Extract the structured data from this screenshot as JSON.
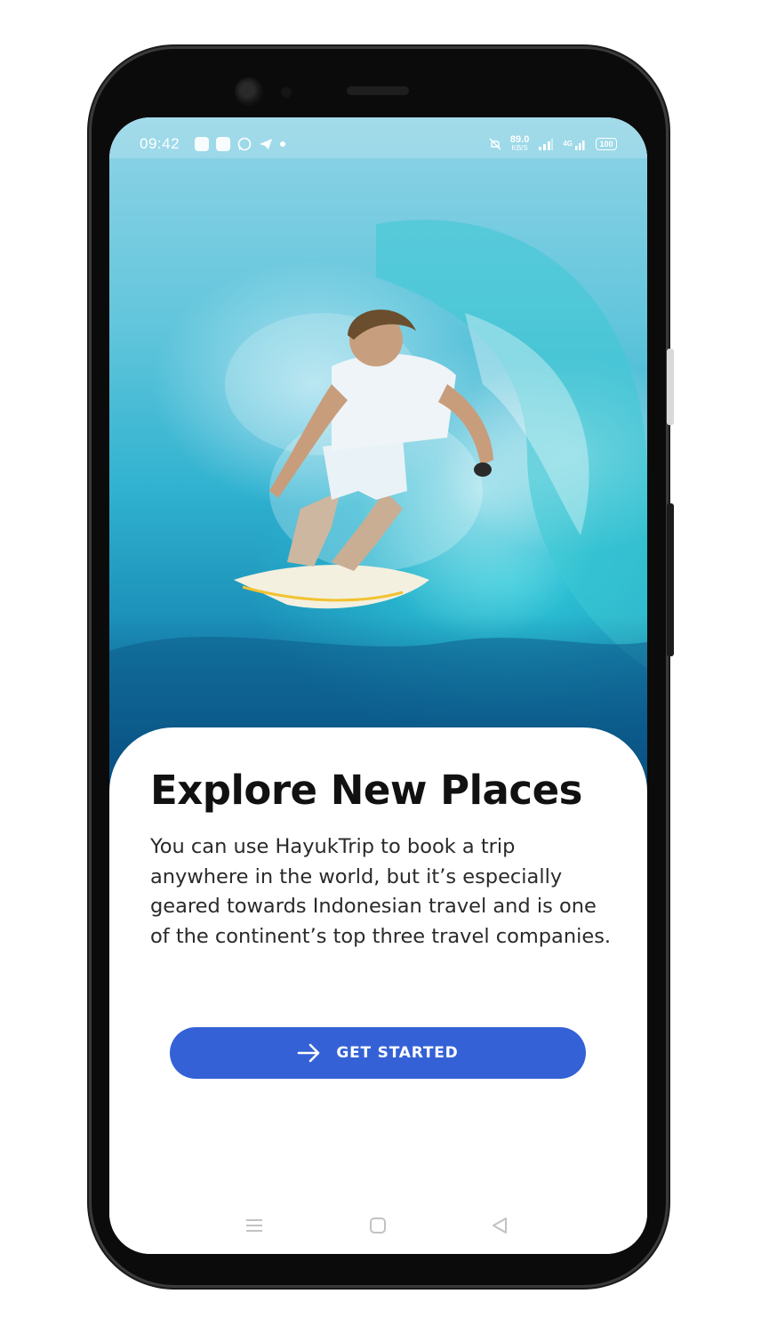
{
  "status_bar": {
    "time": "09:42",
    "speed_value": "89.0",
    "speed_unit": "KB/S",
    "network": "4G",
    "battery": "100",
    "icons_left": [
      "app-notification-icon",
      "chat-notification-icon",
      "whatsapp-icon",
      "telegram-icon",
      "more-dot-icon"
    ],
    "icons_right": [
      "mute-bell-icon",
      "signal-icon",
      "signal-4g-icon",
      "battery-icon"
    ]
  },
  "hero": {
    "image": "surfer-riding-wave-photo"
  },
  "onboarding": {
    "title": "Explore New Places",
    "description": "You can use HayukTrip to book a trip anywhere in the world, but it’s especially geared towards Indonesian travel and is one of the continent’s top three travel companies.",
    "cta_label": "GET STARTED",
    "cta_icon": "arrow-right-icon",
    "accent_color": "#3461d6"
  },
  "nav_bar": {
    "buttons": [
      "menu-icon",
      "home-icon",
      "back-icon"
    ]
  }
}
